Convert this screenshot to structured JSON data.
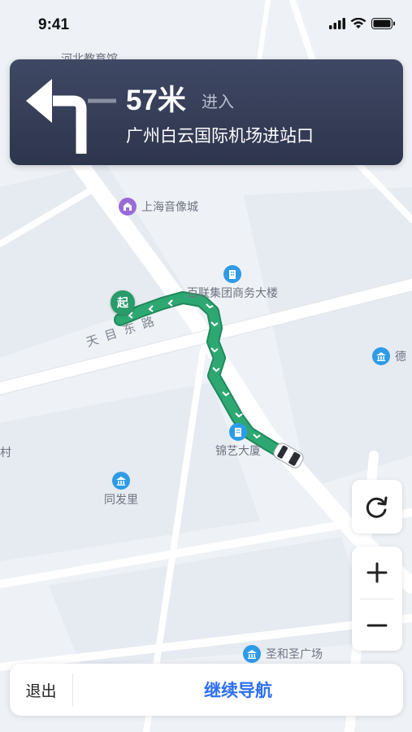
{
  "status_bar": {
    "time": "9:41",
    "icons": [
      "cellular-signal-icon",
      "wifi-icon",
      "battery-icon"
    ]
  },
  "navigation": {
    "maneuver_icon": "turn-left-arrow-icon",
    "distance": "57米",
    "action": "进入",
    "road_name": "广州白云国际机场进站口",
    "top_partial_text": "河北教育馆"
  },
  "map": {
    "road_label": "天目东路",
    "pois": [
      {
        "name": "上海音像城",
        "icon": "building-icon"
      },
      {
        "name": "百联集团商务大楼",
        "icon": "office-building-icon"
      },
      {
        "name": "德",
        "icon": "bank-icon"
      },
      {
        "name": "锦艺大厦",
        "icon": "office-building-icon"
      },
      {
        "name": "同发里",
        "icon": "bank-icon"
      },
      {
        "name": "圣和圣广场",
        "icon": "bank-icon"
      }
    ],
    "left_edge_text": "村",
    "start_marker": "起",
    "colors": {
      "route": "#2a9b6b",
      "background": "#eef1f6",
      "road": "#ffffff",
      "poi_blue": "#2e9be6",
      "poi_purple": "#9a6bd6"
    }
  },
  "controls": {
    "refresh_icon": "refresh-icon",
    "zoom_in_icon": "plus-icon",
    "zoom_out_icon": "minus-icon"
  },
  "bottom_bar": {
    "exit_label": "退出",
    "continue_label": "继续导航",
    "accent_color": "#2e6ff0"
  }
}
